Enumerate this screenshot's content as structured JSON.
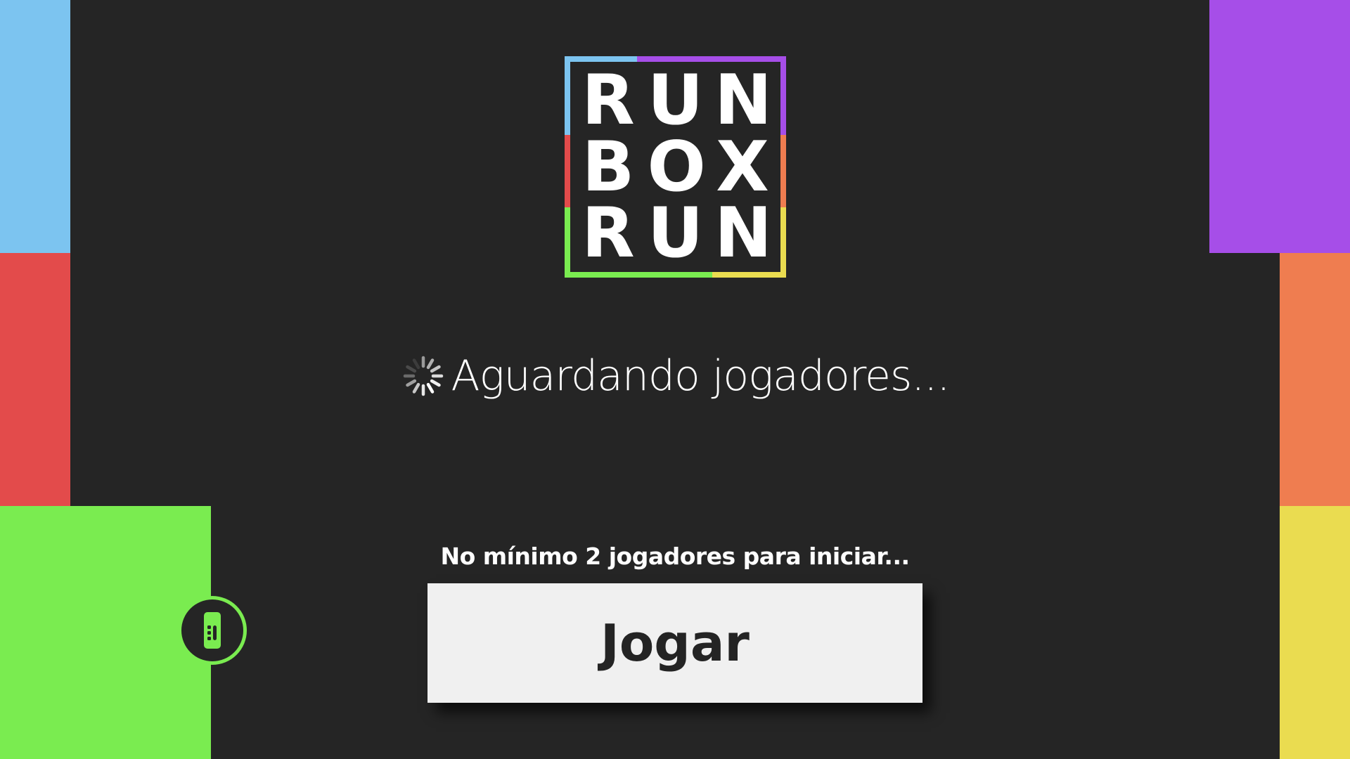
{
  "logo": {
    "rows": [
      [
        "R",
        "U",
        "N"
      ],
      [
        "B",
        "O",
        "X"
      ],
      [
        "R",
        "U",
        "N"
      ]
    ],
    "colors": {
      "blue": "#7cc4f0",
      "purple": "#a64ee8",
      "red": "#e34b4b",
      "orange": "#ef7d50",
      "green": "#7aec50",
      "yellow": "#eadc50"
    }
  },
  "status": {
    "waiting_text": "Aguardando jogadores...",
    "min_players_text": "No mínimo 2 jogadores para iniciar..."
  },
  "play_button": {
    "label": "Jogar"
  },
  "remote_icon": "tv-remote-icon",
  "spinner_icon": "loading-spinner-icon",
  "theme": {
    "background": "#252525",
    "button_background": "#f0f0f0",
    "button_text": "#242424"
  }
}
